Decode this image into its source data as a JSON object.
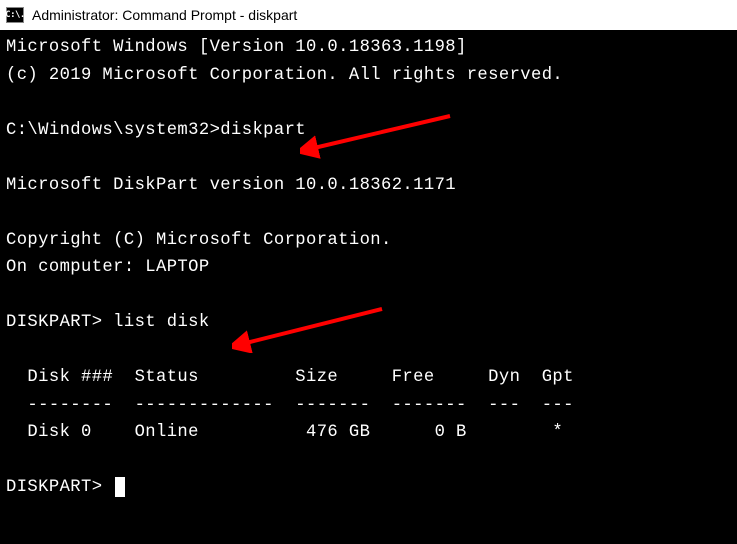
{
  "titlebar": {
    "icon_text": "C:\\.",
    "title": "Administrator: Command Prompt - diskpart"
  },
  "terminal": {
    "line1": "Microsoft Windows [Version 10.0.18363.1198]",
    "line2": "(c) 2019 Microsoft Corporation. All rights reserved.",
    "prompt1_path": "C:\\Windows\\system32>",
    "prompt1_cmd": "diskpart",
    "diskpart_version": "Microsoft DiskPart version 10.0.18362.1171",
    "copyright": "Copyright (C) Microsoft Corporation.",
    "computer": "On computer: LAPTOP",
    "prompt2_label": "DISKPART> ",
    "prompt2_cmd": "list disk",
    "table_header": "  Disk ###  Status         Size     Free     Dyn  Gpt",
    "table_divider": "  --------  -------------  -------  -------  ---  ---",
    "table_row1": "  Disk 0    Online          476 GB      0 B        *",
    "prompt3_label": "DISKPART> "
  },
  "chart_data": {
    "type": "table",
    "title": "list disk",
    "columns": [
      "Disk ###",
      "Status",
      "Size",
      "Free",
      "Dyn",
      "Gpt"
    ],
    "rows": [
      {
        "Disk ###": "Disk 0",
        "Status": "Online",
        "Size": "476 GB",
        "Free": "0 B",
        "Dyn": "",
        "Gpt": "*"
      }
    ]
  },
  "annotations": {
    "arrow_color": "#ff0000"
  }
}
